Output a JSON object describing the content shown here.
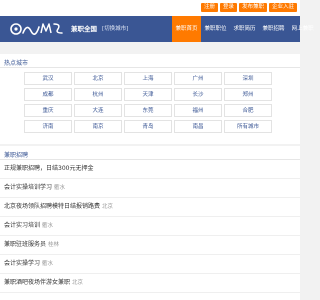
{
  "topbar": {
    "buttons": [
      "注册",
      "登录",
      "发布兼职",
      "企业入驻"
    ]
  },
  "header": {
    "logo_text": "兼职e族",
    "site_name": "兼职全国",
    "city_switch": "[切换城市]",
    "nav": [
      "兼职首页",
      "兼职职位",
      "求职简历",
      "兼职招聘",
      "网上兼职"
    ]
  },
  "hot_cities": {
    "title": "热点城市",
    "cities": [
      "武汉",
      "北京",
      "上海",
      "广州",
      "深圳",
      "成都",
      "杭州",
      "天津",
      "长沙",
      "郑州",
      "重庆",
      "大连",
      "东莞",
      "福州",
      "合肥",
      "济南",
      "南京",
      "青岛",
      "南昌",
      "所有城市"
    ]
  },
  "jobs": {
    "title": "兼职招聘",
    "items": [
      {
        "title": "正规兼职招聘，日结300元无押金",
        "tag": ""
      },
      {
        "title": "会计实操培训学习",
        "tag": "衢水"
      },
      {
        "title": "北京夜场领队招聘模特日结报销路费",
        "tag": "北京"
      },
      {
        "title": "会计实习培训",
        "tag": "衢水"
      },
      {
        "title": "兼职驻班服务员",
        "tag": "桂林"
      },
      {
        "title": "会计实操学习",
        "tag": "衢水"
      },
      {
        "title": "兼职酒吧夜场伴游女兼职",
        "tag": "北京"
      }
    ]
  },
  "colors": {
    "header_bg": "#3a5694",
    "accent": "#ff7a00",
    "link": "#3a5694"
  }
}
